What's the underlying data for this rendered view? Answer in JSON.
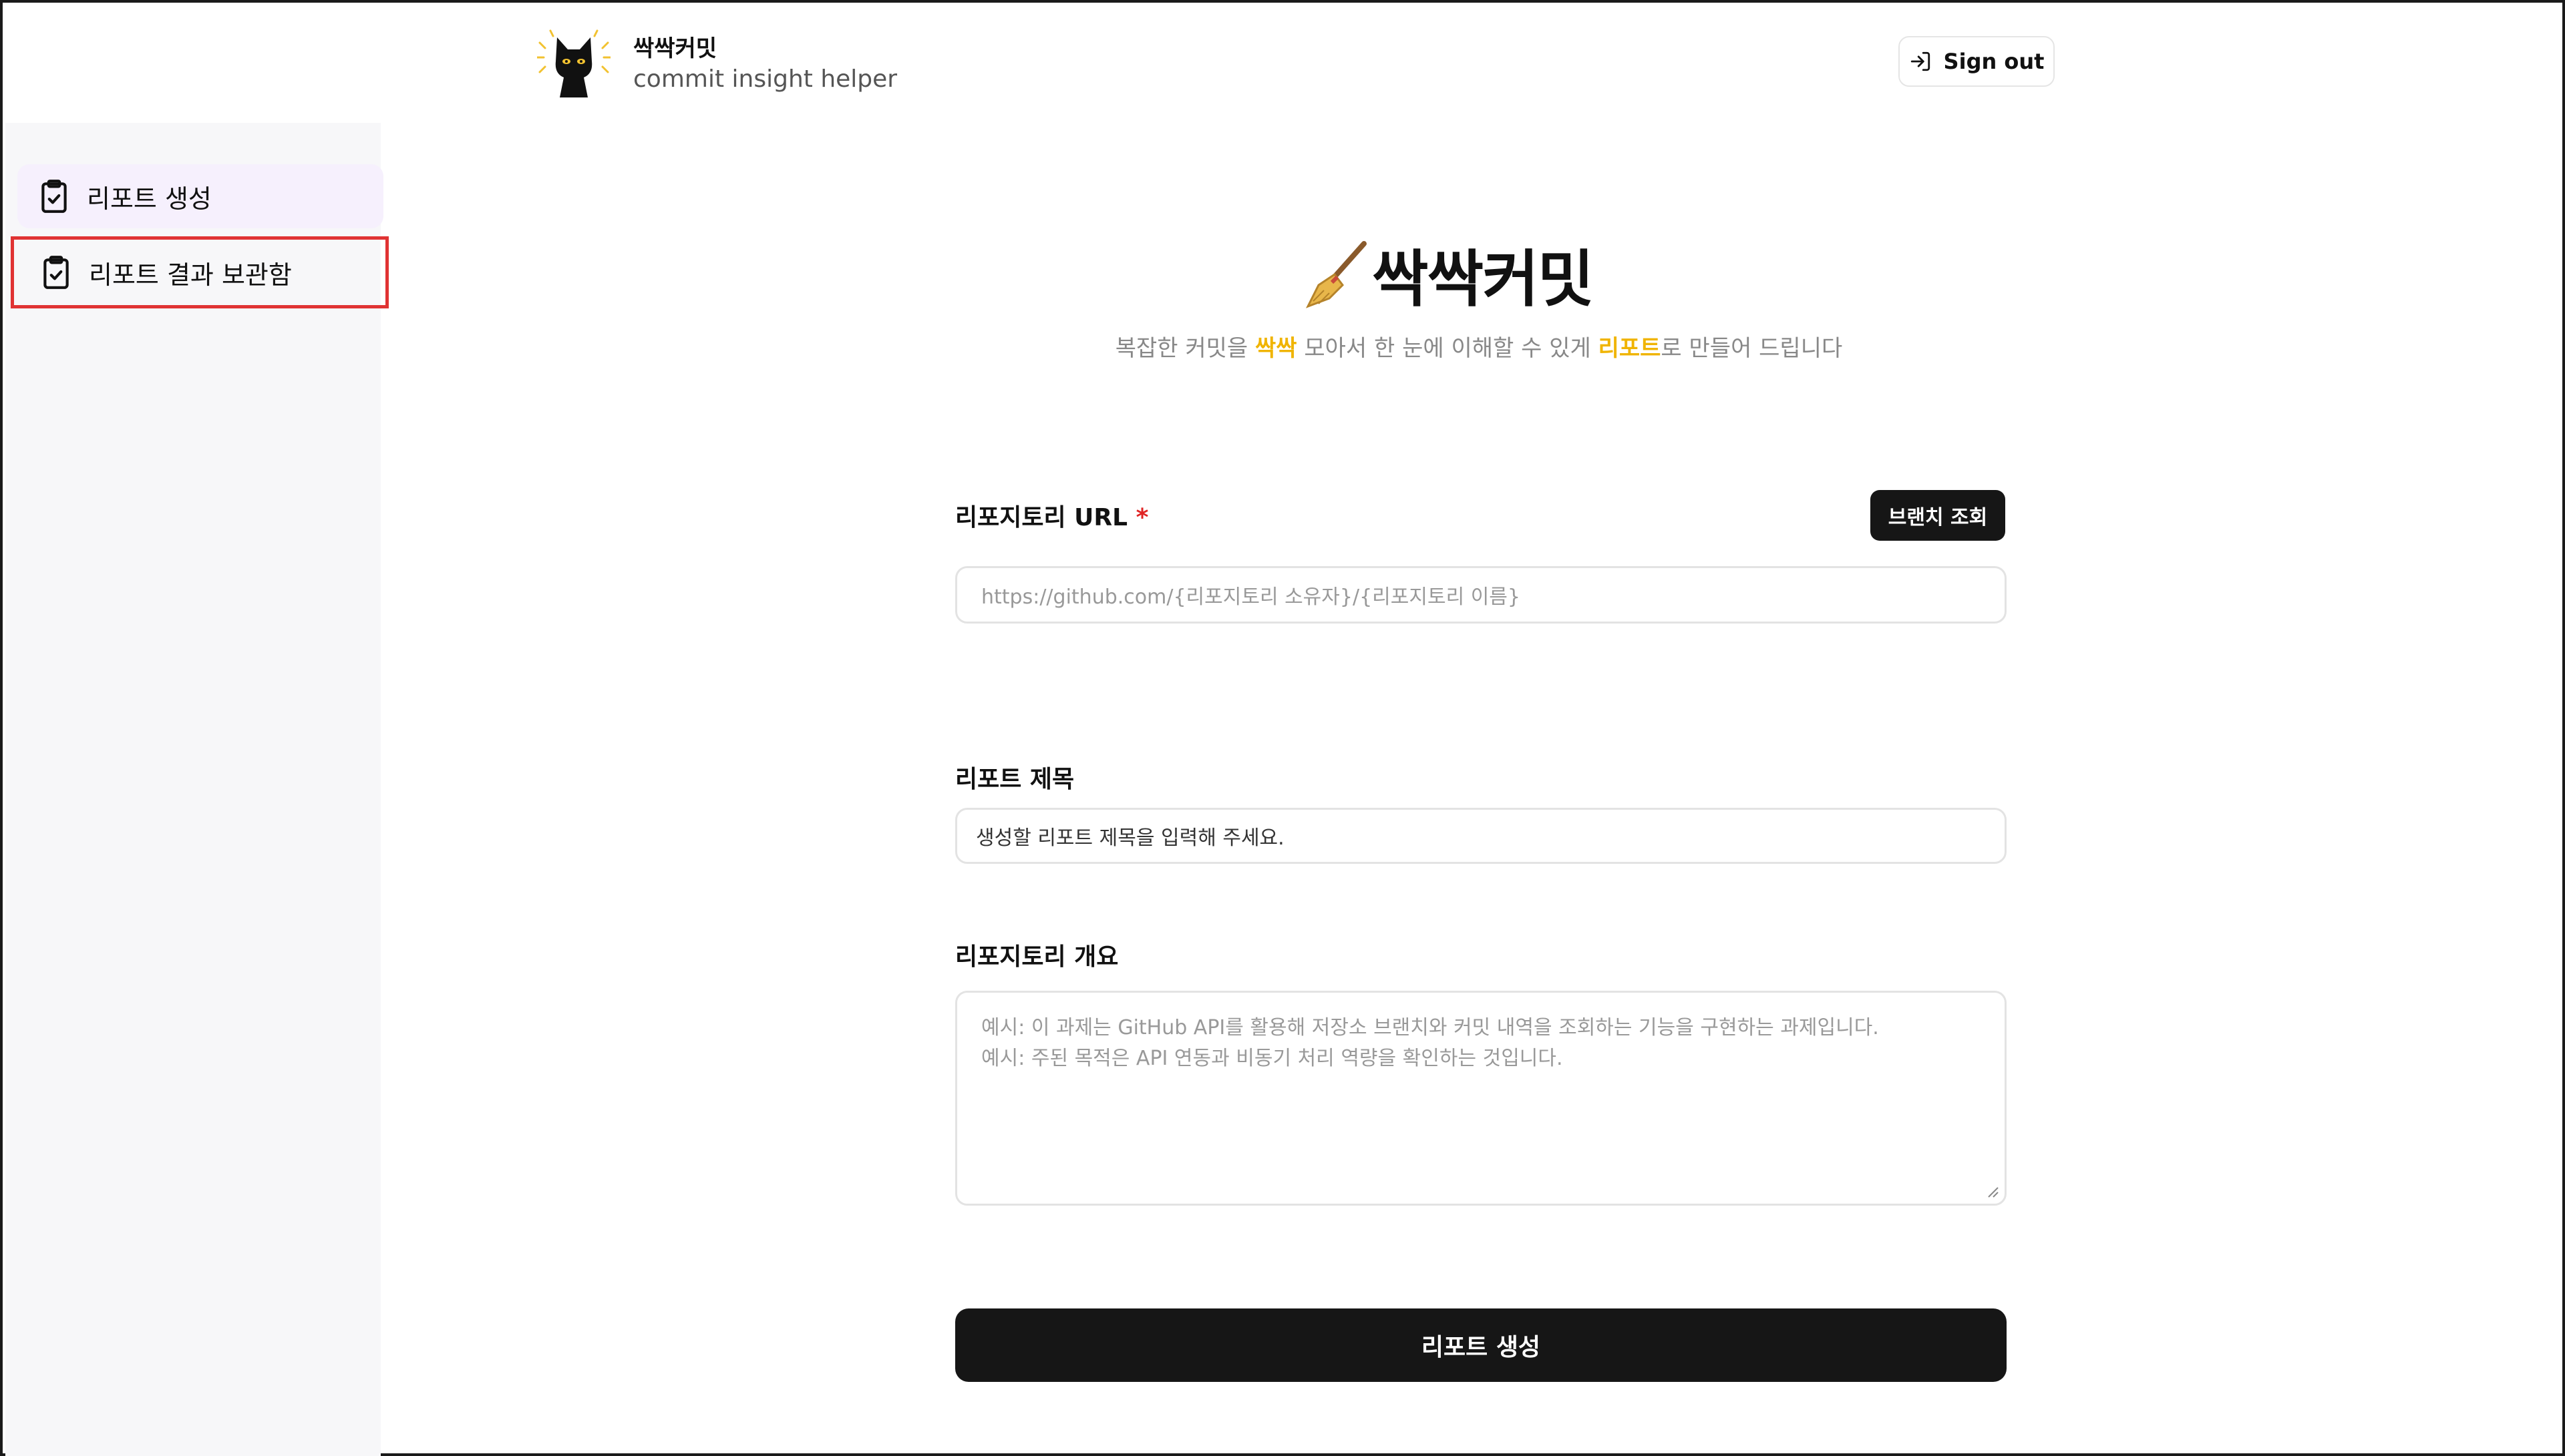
{
  "header": {
    "brand_name": "싹싹커밋",
    "brand_sub": "commit insight helper",
    "signout_label": "Sign out",
    "logo_icon": "black-cat-logo-icon",
    "signout_icon": "sign-in-arrow-icon"
  },
  "sidebar": {
    "items": [
      {
        "label": "리포트 생성",
        "icon": "clipboard-check-icon",
        "active": true
      },
      {
        "label": "리포트 결과 보관함",
        "icon": "clipboard-check-icon",
        "highlighted": true
      }
    ]
  },
  "hero": {
    "icon": "broom-icon",
    "title": "싹싹커밋",
    "sub_part1": "복잡한 커밋을 ",
    "sub_hl1": "싹싹",
    "sub_part2": " 모아서 한 눈에 이해할 수 있게 ",
    "sub_hl2": "리포트",
    "sub_part3": "로 만들어 드립니다"
  },
  "form": {
    "repo_url_label": "리포지토리 URL",
    "required_mark": "*",
    "branch_button": "브랜치 조회",
    "repo_url_placeholder": "https://github.com/{리포지토리 소유자}/{리포지토리 이름}",
    "title_label": "리포트 제목",
    "title_value": "생성할 리포트 제목을 입력해 주세요.",
    "overview_label": "리포지토리 개요",
    "overview_placeholder_line1": "예시: 이 과제는 GitHub API를 활용해 저장소 브랜치와 커밋 내역을 조회하는 기능을 구현하는 과제입니다.",
    "overview_placeholder_line2": "예시: 주된 목적은 API 연동과 비동기 처리 역량을 확인하는 것입니다.",
    "submit_label": "리포트 생성"
  },
  "colors": {
    "accent_yellow": "#f0b400",
    "button_dark": "#161616",
    "sidebar_active_bg": "#f6f0fd",
    "highlight_box": "#e03333",
    "required_red": "#e02424"
  }
}
